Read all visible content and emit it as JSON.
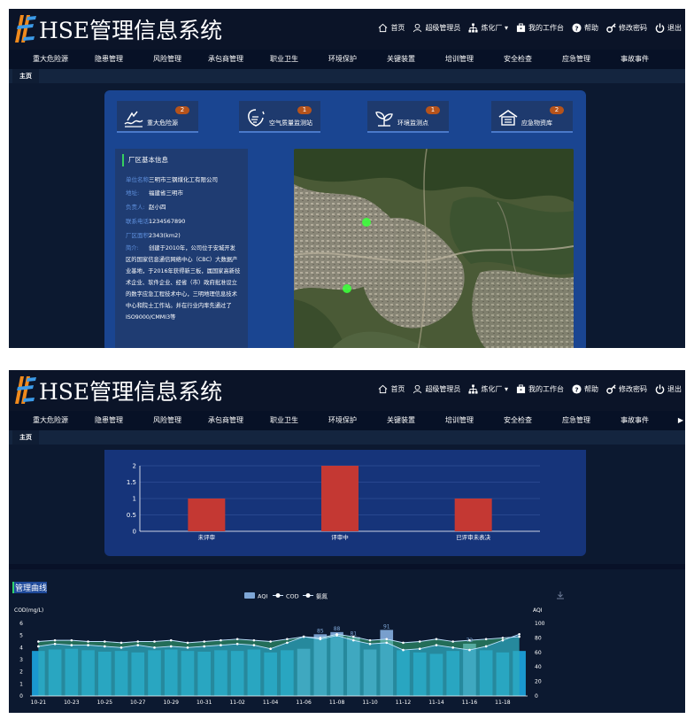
{
  "app": {
    "title": "HSE管理信息系统",
    "top_links": [
      {
        "label": "首页",
        "icon": "home-icon"
      },
      {
        "label": "超级管理员",
        "icon": "user-icon"
      },
      {
        "label": "炼化厂 ▾",
        "icon": "org-tree-icon"
      },
      {
        "label": "我的工作台",
        "icon": "workbench-icon"
      },
      {
        "label": "帮助",
        "icon": "help-icon"
      },
      {
        "label": "修改密码",
        "icon": "key-icon"
      },
      {
        "label": "退出",
        "icon": "power-icon"
      }
    ],
    "nav": [
      "重大危险源",
      "隐患管理",
      "风险管理",
      "承包商管理",
      "职业卫生",
      "环境保护",
      "关键装置",
      "培训管理",
      "安全检查",
      "应急管理",
      "事故事件"
    ],
    "nav_more": "▶",
    "tab": "主页"
  },
  "cards": [
    {
      "label": "重大危险源",
      "count": "2",
      "icon": "hazard-wave-icon"
    },
    {
      "label": "空气质量监测站",
      "count": "1",
      "icon": "air-quality-icon"
    },
    {
      "label": "环境监测点",
      "count": "1",
      "icon": "environment-leaf-icon"
    },
    {
      "label": "应急物资库",
      "count": "2",
      "icon": "warehouse-icon"
    }
  ],
  "factory": {
    "heading": "厂区基本信息",
    "rows": [
      {
        "key": "单位名称:",
        "value": "三明市三钢煤化工有限公司"
      },
      {
        "key": "地址:",
        "value": "福建省三明市"
      },
      {
        "key": "负责人:",
        "value": "赵小四"
      },
      {
        "key": "联系电话:",
        "value": "1234567890"
      },
      {
        "key": "厂区面积:",
        "value": "2343(km2)"
      }
    ],
    "intro_key": "简介:",
    "intro": "创建于2010年，公司位于安城开发区的国家信息通信网络中心（CBC）大数据产业基地，于2016年获得新三板，属国家高新技术企业、软件企业、经省（市）政府批准设立的数字应急工程技术中心，三明地理信息技术中心和院士工作站。并在行业内率先通过了ISO9000/CMMI3等"
  },
  "colors": {
    "header_bg": "#0b1428",
    "panel_bg": "#1a4591",
    "bar_red": "#c43833",
    "accent_green": "#36d05f",
    "badge": "#b6531b",
    "aqi_bar": "#1b9fd8",
    "cod_area": "#2aa5e2",
    "ammonia_area": "#37b27a"
  },
  "status_chart": {
    "chart_data": {
      "type": "bar",
      "categories": [
        "未评审",
        "评审中",
        "已评审未表决"
      ],
      "values": [
        1,
        2,
        1
      ],
      "ylim": [
        0,
        2
      ],
      "yticks": [
        "0",
        "0.5",
        "1",
        "1.5",
        "2"
      ],
      "grid": true,
      "bar_color": "#c43833"
    }
  },
  "curve": {
    "title": "管理曲线",
    "chart_data": {
      "type": "line",
      "x": [
        "10-21",
        "10-22",
        "10-23",
        "10-24",
        "10-25",
        "10-26",
        "10-27",
        "10-28",
        "10-29",
        "10-30",
        "10-31",
        "11-01",
        "11-02",
        "11-03",
        "11-04",
        "11-05",
        "11-06",
        "11-07",
        "11-08",
        "11-09",
        "11-10",
        "11-11",
        "11-12",
        "11-13",
        "11-14",
        "11-15",
        "11-16",
        "11-17",
        "11-18",
        "11-19"
      ],
      "xticks": [
        "10-21",
        "10-23",
        "10-25",
        "10-27",
        "10-29",
        "10-31",
        "11-02",
        "11-04",
        "11-06",
        "11-08",
        "11-10",
        "11-12",
        "11-14",
        "11-16",
        "11-18"
      ],
      "legend": [
        "AQI",
        "COD",
        "氨氮"
      ],
      "left_axis": {
        "label": "COD(mg/L)",
        "ticks": [
          "0",
          "1",
          "2",
          "3",
          "4",
          "5",
          "6"
        ],
        "range": [
          0,
          6
        ]
      },
      "right_axis": {
        "label": "AQI",
        "ticks": [
          "0",
          "20",
          "40",
          "60",
          "80",
          "100"
        ],
        "range": [
          0,
          100
        ]
      },
      "series": [
        {
          "name": "AQI",
          "axis": "right",
          "values": [
            62,
            64,
            65,
            63,
            61,
            62,
            60,
            63,
            64,
            62,
            61,
            63,
            62,
            64,
            60,
            63,
            65,
            85,
            88,
            81,
            64,
            91,
            63,
            60,
            58,
            62,
            72,
            63,
            60,
            62
          ]
        },
        {
          "name": "COD",
          "axis": "left",
          "values": [
            4.1,
            4.3,
            4.2,
            4.2,
            4.1,
            4.0,
            4.2,
            4.0,
            4.1,
            4.0,
            4.1,
            4.2,
            4.3,
            4.2,
            3.9,
            4.4,
            4.9,
            4.7,
            5.0,
            4.6,
            4.3,
            4.4,
            3.8,
            3.9,
            4.2,
            4.0,
            3.8,
            4.1,
            4.6,
            5.1
          ]
        },
        {
          "name": "氨氮",
          "axis": "left",
          "values": [
            4.5,
            4.6,
            4.6,
            4.5,
            4.5,
            4.4,
            4.5,
            4.5,
            4.6,
            4.4,
            4.5,
            4.6,
            4.7,
            4.6,
            4.5,
            4.7,
            4.9,
            4.8,
            5.1,
            4.9,
            4.6,
            4.7,
            4.4,
            4.5,
            4.7,
            4.5,
            4.6,
            4.7,
            4.8,
            4.9
          ]
        }
      ],
      "labels": [
        {
          "index": 17,
          "text": "85"
        },
        {
          "index": 18,
          "text": "88"
        },
        {
          "index": 19,
          "text": "81"
        },
        {
          "index": 21,
          "text": "91"
        },
        {
          "index": 26,
          "text": "72"
        }
      ]
    }
  }
}
